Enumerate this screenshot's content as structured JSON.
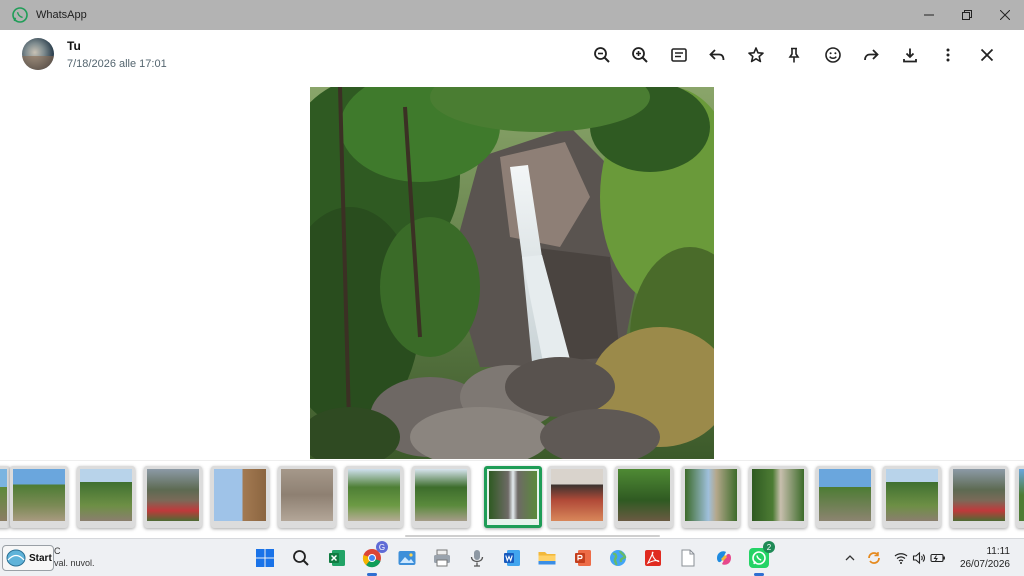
{
  "window": {
    "title": "WhatsApp"
  },
  "header": {
    "sender": "Tu",
    "timestamp": "7/18/2026 alle 17:01"
  },
  "toolbar": {
    "buttons": [
      {
        "name": "zoom-out",
        "icon": "zoom-out-icon"
      },
      {
        "name": "zoom-in",
        "icon": "zoom-in-icon"
      },
      {
        "name": "caption",
        "icon": "caption-icon"
      },
      {
        "name": "reply",
        "icon": "reply-icon"
      },
      {
        "name": "star",
        "icon": "star-icon"
      },
      {
        "name": "pin",
        "icon": "pin-icon"
      },
      {
        "name": "react",
        "icon": "emoji-icon"
      },
      {
        "name": "forward",
        "icon": "forward-icon"
      },
      {
        "name": "download",
        "icon": "download-icon"
      },
      {
        "name": "more",
        "icon": "more-vertical-icon"
      },
      {
        "name": "close",
        "icon": "close-icon"
      }
    ]
  },
  "thumbnails": [
    {
      "scene": "valley"
    },
    {
      "scene": "valley"
    },
    {
      "scene": "village"
    },
    {
      "scene": "chalet"
    },
    {
      "scene": "rock"
    },
    {
      "scene": "forest"
    },
    {
      "scene": "forest"
    },
    {
      "scene": "waterfall",
      "selected": true
    },
    {
      "scene": "group"
    },
    {
      "scene": "forest"
    },
    {
      "scene": "river"
    },
    {
      "scene": "river"
    },
    {
      "scene": "valley"
    },
    {
      "scene": "valley"
    },
    {
      "scene": "village"
    }
  ],
  "taskbar": {
    "start_label": "Start",
    "weather_temp": "C",
    "weather_desc": "val. nuvol.",
    "whatsapp_badge": "2",
    "clock_time": "11:11",
    "clock_date": "26/07/2026"
  },
  "colors": {
    "accent_green": "#1f9d57",
    "titlebar": "#b3b3b3",
    "taskbar": "#eef0f3"
  }
}
